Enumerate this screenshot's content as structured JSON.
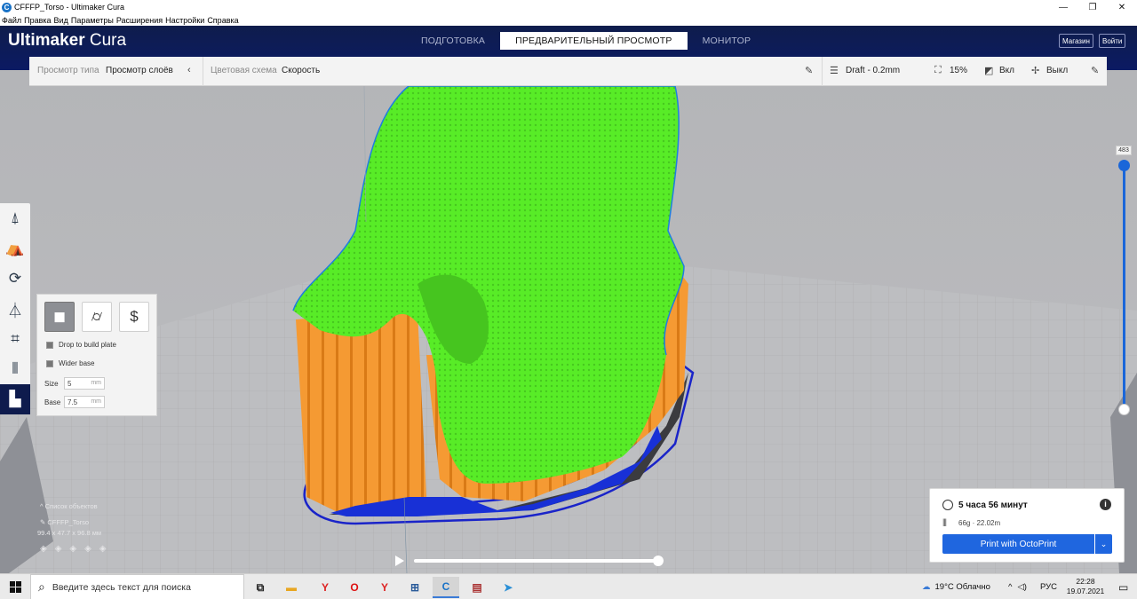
{
  "window": {
    "title": "CFFFP_Torso - Ultimaker Cura",
    "minimize": "—",
    "maximize": "❐",
    "close": "✕"
  },
  "menu": [
    "Файл",
    "Правка",
    "Вид",
    "Параметры",
    "Расширения",
    "Настройки",
    "Справка"
  ],
  "header": {
    "logo_bold": "Ultimaker",
    "logo_light": "Cura",
    "tabs": [
      "ПОДГОТОВКА",
      "ПРЕДВАРИТЕЛЬНЫЙ ПРОСМОТР",
      "МОНИТОР"
    ],
    "active_tab": 1,
    "store_label": "Магазин",
    "login_label": "Войти"
  },
  "viewbar": {
    "view_type_label": "Просмотр типа",
    "view_type_value": "Просмотр слоёв",
    "color_scheme_label": "Цветовая схема",
    "color_scheme_value": "Скорость",
    "profile": "Draft - 0.2mm",
    "infill": "15%",
    "support": "Вкл",
    "adhesion": "Выкл"
  },
  "panel": {
    "drop_label": "Drop to build plate",
    "wider_label": "Wider base",
    "size_label": "Size",
    "size_value": "5",
    "base_label": "Base",
    "base_value": "7.5",
    "unit": "mm"
  },
  "layer_slider": {
    "value": "483",
    "max_layer": 483,
    "min_layer": 1
  },
  "object_list": {
    "header": "Список объектов",
    "object_name": "CFFFP_Torso",
    "dimensions": "99.4 x 47.7 x 96.8 мм"
  },
  "print": {
    "time": "5 часа 56 минут",
    "material": "66g · 22.02m",
    "button_label": "Print with OctoPrint",
    "info_icon": "i"
  },
  "taskbar": {
    "search_placeholder": "Введите здесь текст для поиска",
    "weather": "19°C  Облачно",
    "language": "РУС",
    "time": "22:28",
    "date": "19.07.2021"
  },
  "colors": {
    "header_bg": "#0b1a63",
    "accent": "#1f66df",
    "model_top": "#5cf22a",
    "support": "#f5962e",
    "build_plate": "#bdbdc0"
  }
}
